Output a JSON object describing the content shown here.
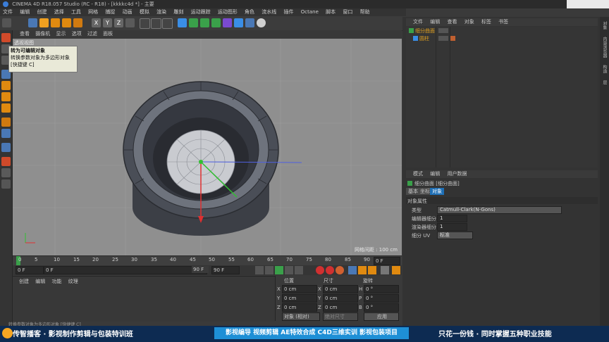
{
  "window": {
    "title": "CINEMA 4D R18.057 Studio (RC - R18) - [kkkkc4d *] - 主要"
  },
  "menubar": [
    "文件",
    "编辑",
    "创建",
    "选择",
    "工具",
    "网格",
    "捕捉",
    "动画",
    "模拟",
    "渲染",
    "雕刻",
    "运动跟踪",
    "运动图形",
    "角色",
    "流水线",
    "插件",
    "Octane",
    "脚本",
    "窗口",
    "帮助"
  ],
  "toolbar": {
    "axis_buttons": [
      "X",
      "Y",
      "Z"
    ]
  },
  "viewport": {
    "menu": [
      "查看",
      "摄像机",
      "显示",
      "选项",
      "过滤",
      "面板"
    ],
    "tab": "透视视图",
    "grid_info": "网格间距 : 100 cm"
  },
  "tooltip": {
    "title": "转为可编辑对象",
    "desc": "转换参数对象为多边形对象",
    "shortcut": "[快捷键 C]"
  },
  "timeline": {
    "ticks": [
      "0",
      "5",
      "10",
      "15",
      "20",
      "25",
      "30",
      "35",
      "40",
      "45",
      "50",
      "55",
      "60",
      "65",
      "70",
      "75",
      "80",
      "85",
      "90"
    ],
    "end_field": "0 F",
    "start": "0 F",
    "current": "0 F",
    "end": "90 F",
    "end2": "90 F"
  },
  "material_panel": {
    "menu": [
      "创建",
      "编辑",
      "功能",
      "纹理"
    ],
    "status": "转换参数对象为多边形对象 [快捷键 C]"
  },
  "coords": {
    "headers": [
      "位置",
      "尺寸",
      "旋转"
    ],
    "rows": [
      {
        "axis": "X",
        "pos": "0 cm",
        "size_axis": "X",
        "size": "0 cm",
        "rot_axis": "H",
        "rot": "0 °"
      },
      {
        "axis": "Y",
        "pos": "0 cm",
        "size_axis": "Y",
        "size": "0 cm",
        "rot_axis": "P",
        "rot": "0 °"
      },
      {
        "axis": "Z",
        "pos": "0 cm",
        "size_axis": "Z",
        "size": "0 cm",
        "rot_axis": "B",
        "rot": "0 °"
      }
    ],
    "mode_select": "对象 (相对)",
    "size_select": "绝对尺寸",
    "apply_label": "应用"
  },
  "objects": {
    "menu": [
      "文件",
      "编辑",
      "查看",
      "对象",
      "标签",
      "书签"
    ],
    "items": [
      "细分曲面",
      "圆柱"
    ]
  },
  "attributes": {
    "menu": [
      "模式",
      "编辑",
      "用户数据"
    ],
    "object_title": "细分曲面 [细分曲面]",
    "tabs": [
      "基本",
      "坐标",
      "对象"
    ],
    "section": "对象属性",
    "rows": [
      {
        "label": "类型",
        "value": "Catmull-Clark(N-Gons)"
      },
      {
        "label": "编辑器细分",
        "value": "1"
      },
      {
        "label": "渲染器细分",
        "value": "1"
      },
      {
        "label": "细分 UV",
        "value": "标准"
      }
    ]
  },
  "side_tabs": [
    "对象",
    "内容浏览器",
    "构造",
    "层"
  ],
  "banner": {
    "left": "传智播客 · 影视制作剪辑与包装特训班",
    "mid": "影视编导  视频剪辑  AE特效合成  C4D三维实训  影视包装项目",
    "right": "只花一份钱 · 同时掌握五种职业技能"
  },
  "colors": {
    "accent": "#1e8fd6",
    "banner_bg": "#0d2b52",
    "viewport_bg": "#8f8f8f"
  }
}
